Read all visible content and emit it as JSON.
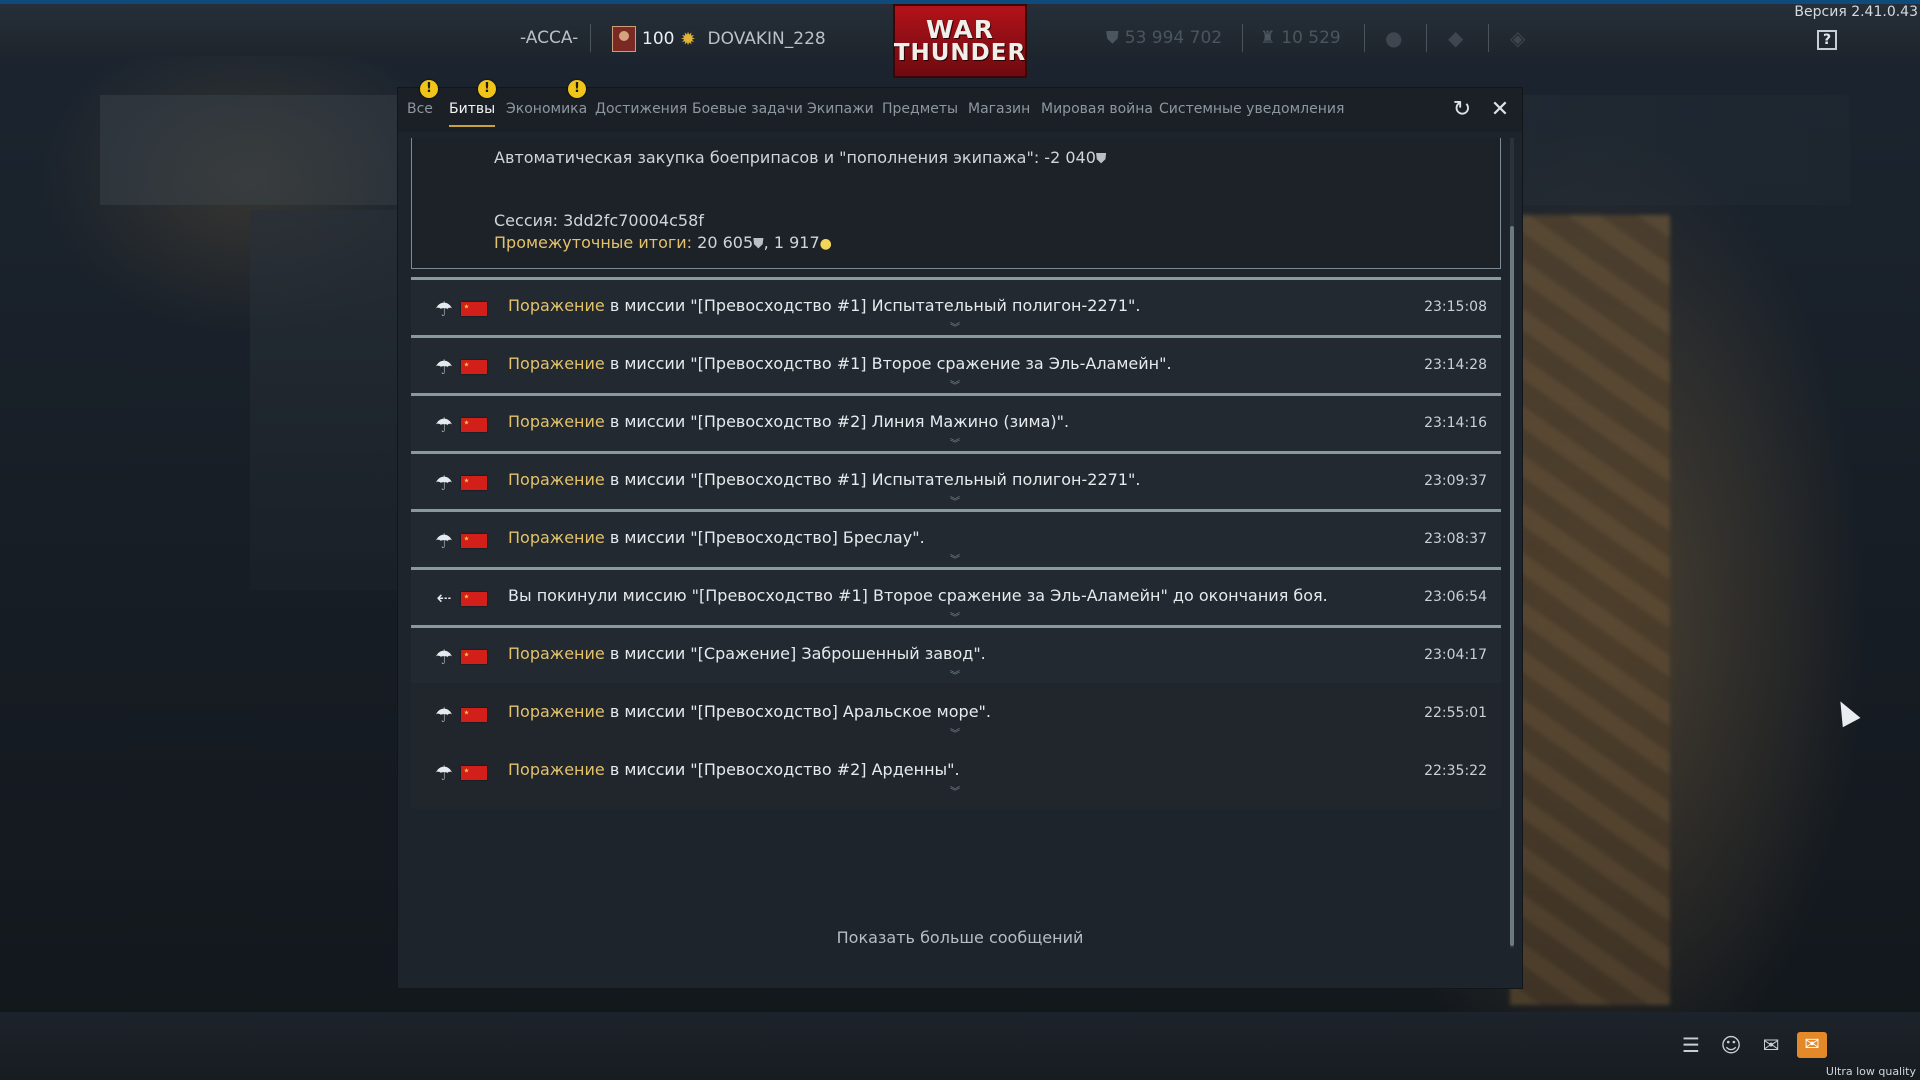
{
  "topbar": {
    "squadron": "-ACCA-",
    "level": "100",
    "nickname": "DOVAKIN_228",
    "logo_line1": "WAR",
    "logo_line2": "THUNDER",
    "silver_lions": "53 994 702",
    "research_points": "10 529",
    "version": "Версия 2.41.0.43",
    "help_label": "?"
  },
  "tabs": [
    {
      "label": "Все",
      "alert": true
    },
    {
      "label": "Битвы",
      "alert": true,
      "active": true
    },
    {
      "label": "Экономика",
      "alert": true
    },
    {
      "label": "Достижения"
    },
    {
      "label": "Боевые задачи"
    },
    {
      "label": "Экипажи"
    },
    {
      "label": "Предметы"
    },
    {
      "label": "Магазин"
    },
    {
      "label": "Мировая война"
    },
    {
      "label": "Системные уведомления"
    }
  ],
  "alert_glyph": "!",
  "expanded_message": {
    "purchase_line": "Автоматическая закупка боеприпасов и \"пополнения экипажа\": -2 040",
    "session_line": "Сессия: 3dd2fc70004c58f",
    "subtotal_label": "Промежуточные итоги:",
    "subtotal_value": "20 605",
    "subtotal_rp": ", 1 917"
  },
  "messages": [
    {
      "icon": "parachute",
      "prefix": "Поражение",
      "text": " в миссии \"[Превосходство #1] Испытательный полигон-2271\".",
      "time": "23:15:08"
    },
    {
      "icon": "parachute",
      "prefix": "Поражение",
      "text": " в миссии \"[Превосходство #1] Второе сражение за Эль-Аламейн\".",
      "time": "23:14:28"
    },
    {
      "icon": "parachute",
      "prefix": "Поражение",
      "text": " в миссии \"[Превосходство #2] Линия Мажино (зима)\".",
      "time": "23:14:16"
    },
    {
      "icon": "parachute",
      "prefix": "Поражение",
      "text": " в миссии \"[Превосходство #1] Испытательный полигон-2271\".",
      "time": "23:09:37"
    },
    {
      "icon": "parachute",
      "prefix": "Поражение",
      "text": " в миссии \"[Превосходство] Бреслау\".",
      "time": "23:08:37"
    },
    {
      "icon": "leave",
      "prefix": "",
      "text": "Вы покинули миссию \"[Превосходство #1] Второе сражение за Эль-Аламейн\" до окончания боя.",
      "time": "23:06:54"
    },
    {
      "icon": "parachute",
      "prefix": "Поражение",
      "text": " в миссии \"[Сражение] Заброшенный завод\".",
      "time": "23:04:17"
    },
    {
      "icon": "parachute",
      "prefix": "Поражение",
      "text": " в миссии \"[Превосходство] Аральское море\".",
      "time": "22:55:01"
    },
    {
      "icon": "parachute",
      "prefix": "Поражение",
      "text": " в миссии \"[Превосходство #2] Арденны\".",
      "time": "22:35:22"
    }
  ],
  "show_more": "Показать больше сообщений",
  "quality_label": "Ultra low quality",
  "colors": {
    "accent_gold": "#e3c26a",
    "alert_yellow": "#f0c419",
    "mail_orange": "#e3892a",
    "logo_red": "#b2121a"
  }
}
